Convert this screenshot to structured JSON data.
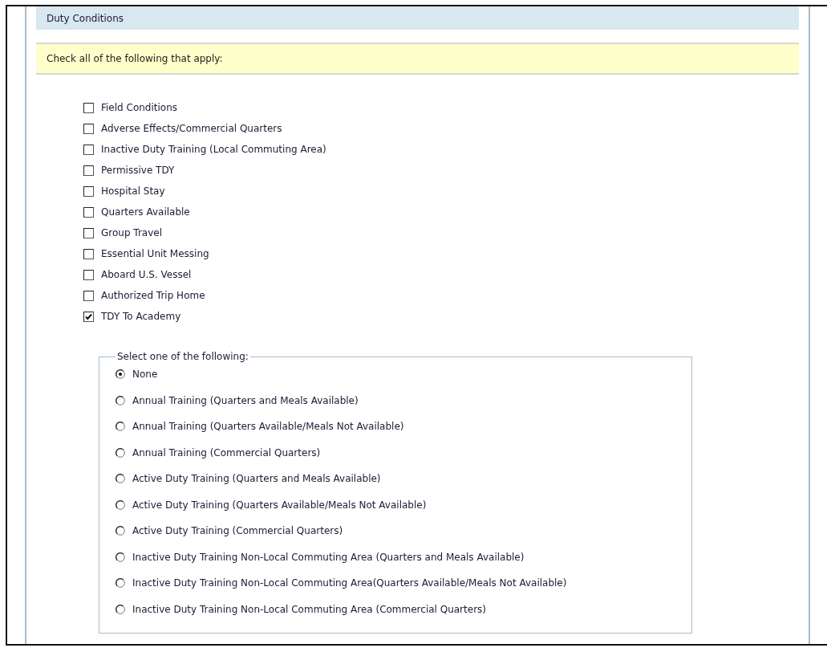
{
  "section": {
    "title": "Duty Conditions"
  },
  "instruction": "Check all of the following that apply:",
  "checkboxes": [
    {
      "label": "Field Conditions",
      "checked": false
    },
    {
      "label": "Adverse Effects/Commercial Quarters",
      "checked": false
    },
    {
      "label": "Inactive Duty Training (Local Commuting Area)",
      "checked": false
    },
    {
      "label": "Permissive TDY",
      "checked": false
    },
    {
      "label": "Hospital Stay",
      "checked": false
    },
    {
      "label": "Quarters Available",
      "checked": false
    },
    {
      "label": "Group Travel",
      "checked": false
    },
    {
      "label": "Essential Unit Messing",
      "checked": false
    },
    {
      "label": "Aboard U.S. Vessel",
      "checked": false
    },
    {
      "label": "Authorized Trip Home",
      "checked": false
    },
    {
      "label": "TDY To Academy",
      "checked": true
    }
  ],
  "radio_group": {
    "legend": "Select one of the following:",
    "options": [
      {
        "label": "None",
        "selected": true
      },
      {
        "label": "Annual Training (Quarters and Meals Available)",
        "selected": false
      },
      {
        "label": "Annual Training (Quarters Available/Meals Not Available)",
        "selected": false
      },
      {
        "label": "Annual Training (Commercial Quarters)",
        "selected": false
      },
      {
        "label": "Active Duty Training (Quarters and Meals Available)",
        "selected": false
      },
      {
        "label": "Active Duty Training (Quarters Available/Meals Not Available)",
        "selected": false
      },
      {
        "label": "Active Duty Training (Commercial Quarters)",
        "selected": false
      },
      {
        "label": "Inactive Duty Training Non-Local Commuting Area (Quarters and Meals Available)",
        "selected": false
      },
      {
        "label": "Inactive Duty Training Non-Local Commuting Area(Quarters Available/Meals Not Available)",
        "selected": false
      },
      {
        "label": "Inactive Duty Training Non-Local Commuting Area (Commercial Quarters)",
        "selected": false
      }
    ]
  }
}
